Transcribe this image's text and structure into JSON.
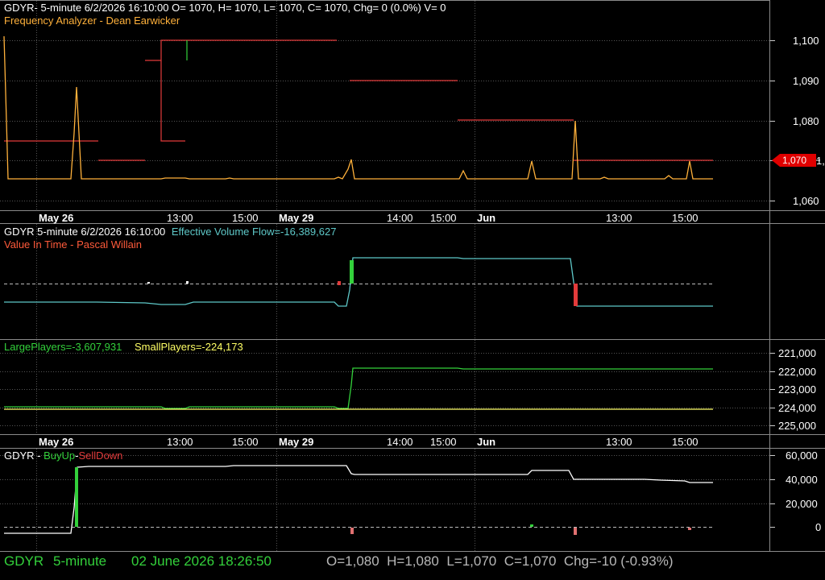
{
  "colors": {
    "white": "#ffffff",
    "orange": "#ffb13b",
    "red": "#e23b3b",
    "green": "#33d13b",
    "cyan": "#5ec8c8",
    "yellow": "#ffff66",
    "salmon": "#ff5a3a",
    "status_green": "#33d13b",
    "status_grey": "#b8b8b8"
  },
  "pane1": {
    "header_line1": "GDYR- 5-minute 6/2/2026 16:10:00 O= 1070, H= 1070, L= 1070, C= 1070, Chg= 0 (0.0%) V= 0",
    "header_line2": "Frequency Analyzer - Dean Earwicker",
    "y_labels": [
      "1,100",
      "1,090",
      "1,080",
      "1,070",
      "1,060"
    ],
    "price_tag": "1,070"
  },
  "time_axis": {
    "dates": [
      "May 26",
      "May 29",
      "Jun"
    ],
    "times": [
      "13:00",
      "15:00",
      "14:00",
      "15:00",
      "13:00",
      "15:00"
    ]
  },
  "pane2": {
    "title_prefix": "GDYR 5-minute  6/2/2026 16:10:00",
    "title_value": "Effective Volume Flow=-16,389,627",
    "subtitle": "Value In Time - Pascal Willain"
  },
  "pane3": {
    "large_players": "LargePlayers=-3,607,931",
    "small_players": "SmallPlayers=-224,173",
    "y_labels": [
      "221,000",
      "222,000",
      "223,000",
      "224,000",
      "225,000"
    ]
  },
  "pane4": {
    "name": "GDYR",
    "sep1": " - ",
    "buy_up": "BuyUp",
    "sep2": "-",
    "sell_down": "SellDown",
    "y_labels": [
      "60,000",
      "40,000",
      "20,000",
      "0"
    ]
  },
  "status_bar": {
    "symbol": "GDYR",
    "interval": "5-minute",
    "datetime": "02 June 2026 18:26:50",
    "quote": "O=1,080  H=1,080  L=1,070  C=1,070  Chg=-10 (-0.93%)"
  }
}
